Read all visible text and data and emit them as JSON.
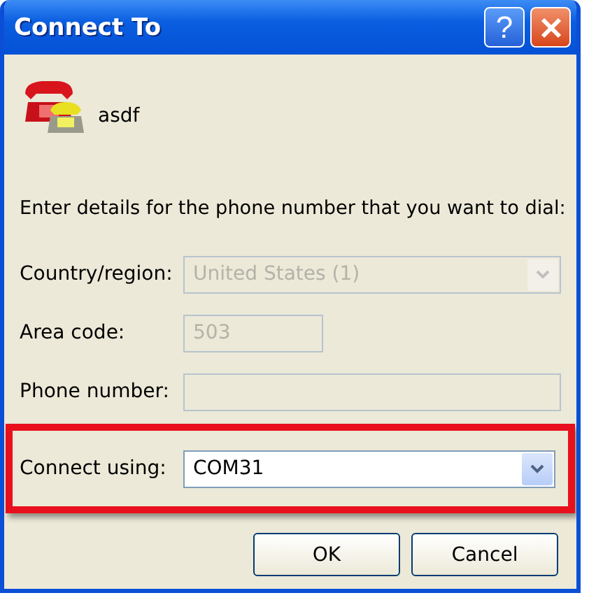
{
  "window": {
    "title": "Connect To",
    "buttons": [
      {
        "kind": "help",
        "label": "?"
      },
      {
        "kind": "close"
      }
    ]
  },
  "connection_name": "asdf",
  "instruction": "Enter details for the phone number that you want to dial:",
  "fields": [
    {
      "label": "Country/region:",
      "kind": "dropdown",
      "value": "United States (1)",
      "disabled": true,
      "highlighted": false
    },
    {
      "label": "Area code:",
      "kind": "text",
      "value": "503",
      "disabled": true,
      "highlighted": false,
      "short": true
    },
    {
      "label": "Phone number:",
      "kind": "text",
      "disabled": true,
      "highlighted": false
    },
    {
      "label": "Connect using:",
      "kind": "dropdown",
      "value": "COM31",
      "disabled": false,
      "highlighted": true
    }
  ],
  "buttons": [
    {
      "label": "OK"
    },
    {
      "label": "Cancel"
    }
  ]
}
